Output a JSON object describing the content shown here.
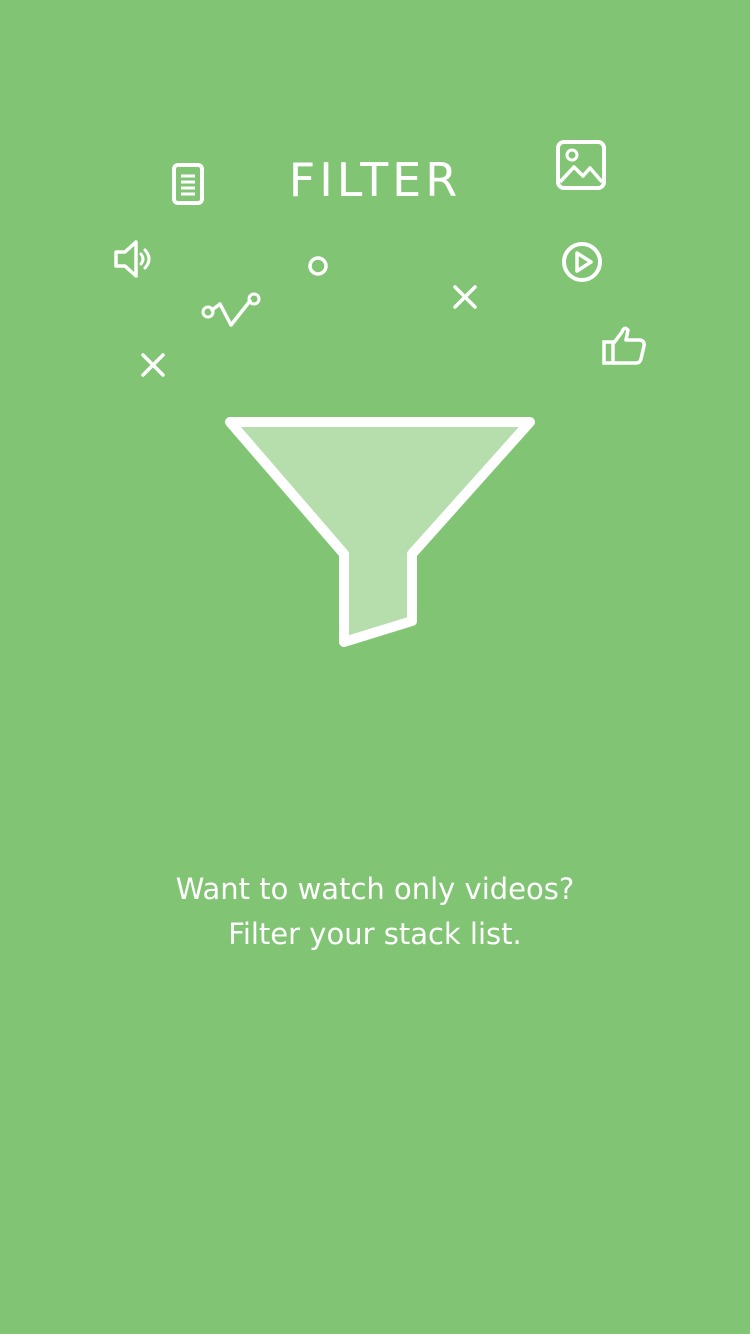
{
  "screen": {
    "background_color": "#81c574",
    "foreground_color": "#ffffff",
    "funnel_fill_color": "#b6dead"
  },
  "header": {
    "title": "FILTER"
  },
  "decorations": [
    "document-icon",
    "speaker-icon",
    "analytics-line-icon",
    "circle-icon",
    "close-icon",
    "close-icon",
    "image-icon",
    "play-icon",
    "thumbs-up-icon"
  ],
  "illustration": {
    "icon": "funnel-icon"
  },
  "message": {
    "line1": "Want to watch only videos?",
    "line2": "Filter your stack list."
  }
}
